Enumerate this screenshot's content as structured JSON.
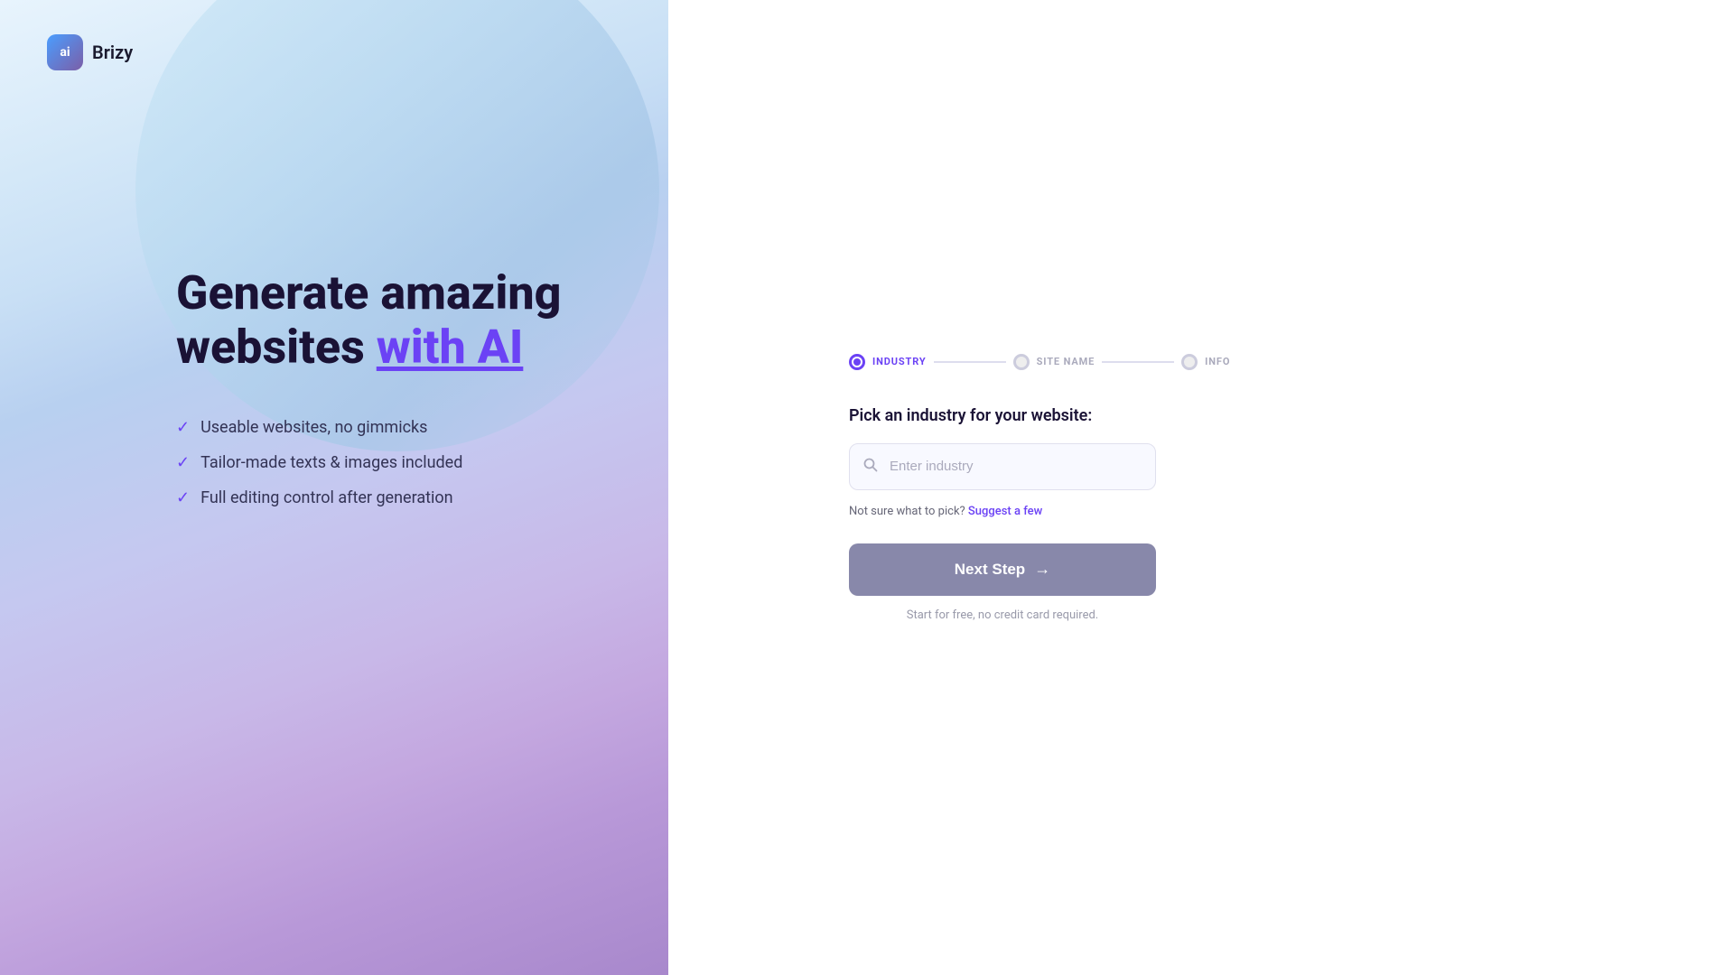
{
  "logo": {
    "icon_label": "ai",
    "name": "Brizy"
  },
  "hero": {
    "headline_line1": "Generate amazing",
    "headline_line2_plain": "websites ",
    "headline_line2_highlight": "with AI",
    "features": [
      {
        "text": "Useable websites, no gimmicks"
      },
      {
        "text": "Tailor-made texts & images included"
      },
      {
        "text": "Full editing control after generation"
      }
    ]
  },
  "steps": [
    {
      "label": "INDUSTRY",
      "state": "active"
    },
    {
      "label": "SITE NAME",
      "state": "inactive"
    },
    {
      "label": "INFO",
      "state": "inactive"
    }
  ],
  "form": {
    "title": "Pick an industry for your website:",
    "input_placeholder": "Enter industry",
    "suggest_text": "Not sure what to pick?",
    "suggest_link": "Suggest a few",
    "next_button_label": "Next Step",
    "free_text": "Start for free, no credit card required."
  }
}
